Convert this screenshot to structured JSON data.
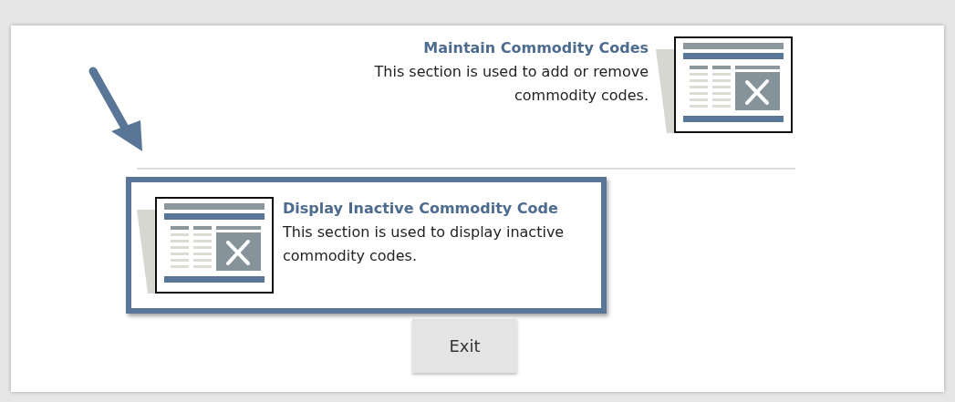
{
  "sections": [
    {
      "title": "Maintain Commodity Codes",
      "description": "This section is used to add or remove commodity codes.",
      "kind": "textfirst",
      "highlighted": false
    },
    {
      "title": "Display Inactive Commodity Code",
      "description": "This section is used to display inactive commodity codes.",
      "kind": "iconfirst",
      "highlighted": true
    }
  ],
  "exit_button": {
    "label": "Exit"
  }
}
